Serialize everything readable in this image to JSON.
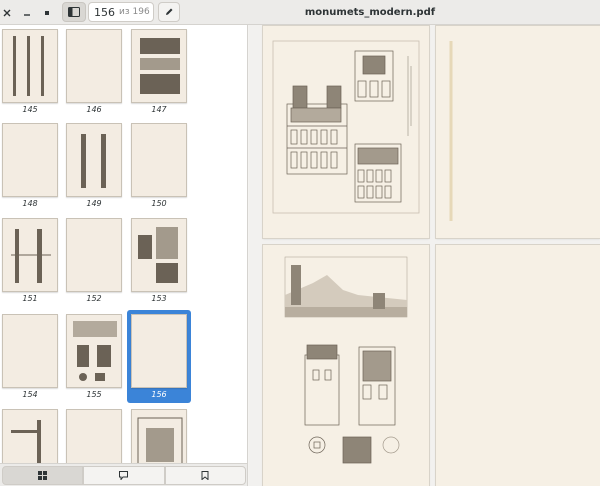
{
  "window": {
    "title": "monumets_modern.pdf"
  },
  "headerbar": {
    "close_glyph": "×",
    "minimize_glyph": "–",
    "maximize_glyph": "▫",
    "page_current": "156",
    "page_of": "из 196"
  },
  "sidebar": {
    "thumbnails": [
      {
        "label": "145"
      },
      {
        "label": "146"
      },
      {
        "label": "147"
      },
      {
        "label": "148"
      },
      {
        "label": "149"
      },
      {
        "label": "150"
      },
      {
        "label": "151"
      },
      {
        "label": "152"
      },
      {
        "label": "153"
      },
      {
        "label": "154"
      },
      {
        "label": "155"
      },
      {
        "label": "156"
      },
      {
        "label": ""
      },
      {
        "label": ""
      },
      {
        "label": ""
      }
    ],
    "selected_label": "156",
    "tabs": [
      {
        "name": "thumbnails",
        "icon": "grid-icon"
      },
      {
        "name": "annotations",
        "icon": "comment-icon"
      },
      {
        "name": "bookmarks",
        "icon": "bookmark-icon"
      }
    ]
  },
  "colors": {
    "accent": "#3b84d8",
    "paper": "#f3ece2",
    "ink": "#6b6256"
  }
}
